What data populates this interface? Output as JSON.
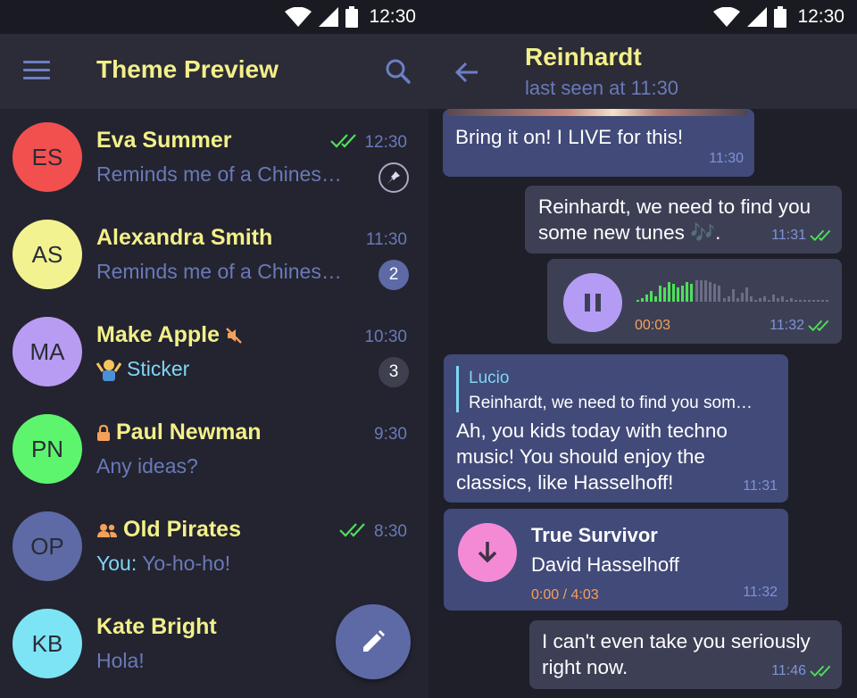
{
  "status_bar": {
    "time": "12:30"
  },
  "chat_list": {
    "title": "Theme Preview",
    "chats": [
      {
        "initials": "ES",
        "name": "Eva Summer",
        "preview": "Reminds me of a Chinese prove…",
        "time": "12:30",
        "avatar_color": "#f2504f",
        "read": true,
        "pinned": true
      },
      {
        "initials": "AS",
        "name": "Alexandra Smith",
        "preview": "Reminds me of a Chinese prove…",
        "time": "11:30",
        "avatar_color": "#f2f291",
        "unread": "2",
        "badge_color": "#5d6aa6"
      },
      {
        "initials": "MA",
        "name": "Make Apple",
        "preview": "Sticker",
        "time": "10:30",
        "avatar_color": "#b89cf3",
        "muted": true,
        "unread": "3",
        "badge_color": "#3e4050",
        "sticker": true
      },
      {
        "initials": "PN",
        "name": "Paul Newman",
        "preview": "Any ideas?",
        "time": "9:30",
        "avatar_color": "#5ef56e",
        "locked": true
      },
      {
        "initials": "OP",
        "name": "Old Pirates",
        "preview_sender": "You:",
        "preview": "Yo-ho-ho!",
        "time": "8:30",
        "avatar_color": "#5d6aa6",
        "group": true,
        "read": true
      },
      {
        "initials": "KB",
        "name": "Kate Bright",
        "preview": "Hola!",
        "avatar_color": "#7de4f5"
      }
    ]
  },
  "chat": {
    "title": "Reinhardt",
    "subtitle": "last seen at 11:30",
    "messages": [
      {
        "dir": "in",
        "text": "Bring it on! I LIVE for this!",
        "time": "11:30"
      },
      {
        "dir": "out",
        "text_line1": "Reinhardt, we need to find you",
        "text_line2": "some new tunes 🎶.",
        "time": "11:31",
        "read": true
      },
      {
        "dir": "out",
        "type": "voice",
        "duration": "00:03",
        "time": "11:32",
        "read": true
      },
      {
        "dir": "in",
        "reply_name": "Lucio",
        "reply_text": "Reinhardt, we need to find you som…",
        "text_line1": "Ah, you kids today with techno",
        "text_line2": "music! You should enjoy the",
        "text_line3": "classics, like Hasselhoff!",
        "time": "11:31"
      },
      {
        "dir": "in",
        "type": "audio",
        "track": "True Survivor",
        "artist": "David Hasselhoff",
        "duration": "0:00 / 4:03",
        "time": "11:32"
      },
      {
        "dir": "out",
        "text_line1": "I can't even take you seriously",
        "text_line2": "right now.",
        "time": "11:46",
        "read": true
      }
    ]
  },
  "colors": {
    "accent_yellow": "#f3f08a",
    "muted_blue": "#6a79b8",
    "check_green": "#4ee05a",
    "fab": "#5e6aa6"
  }
}
